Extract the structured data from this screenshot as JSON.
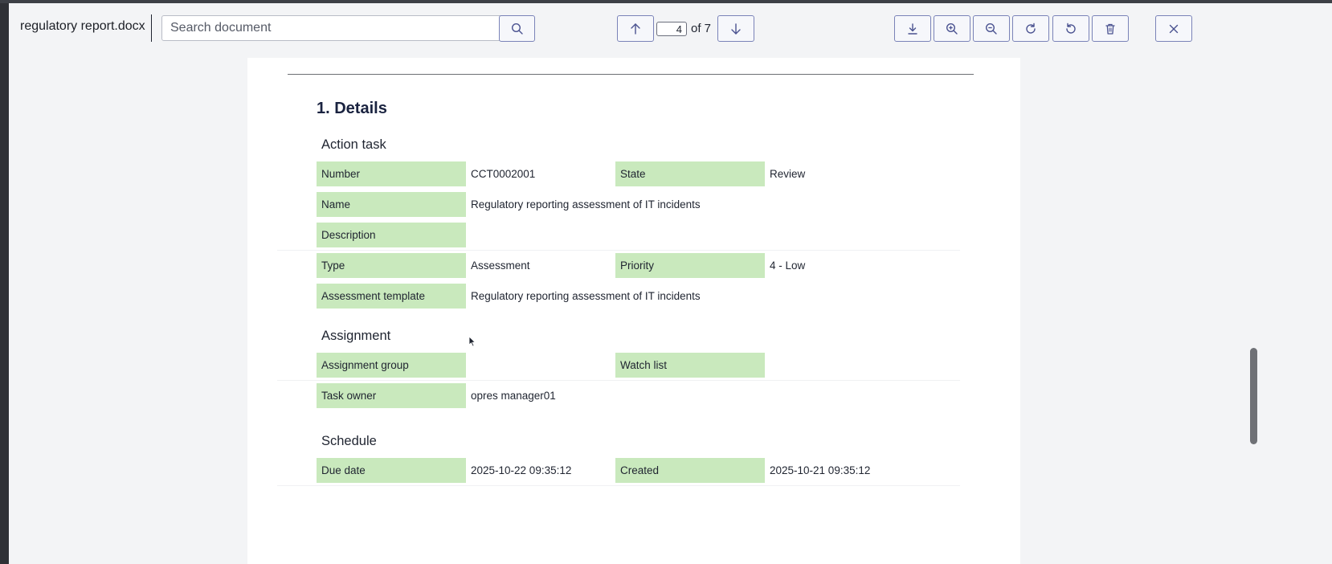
{
  "toolbar": {
    "document_name": "regulatory report.docx",
    "search_placeholder": "Search document",
    "search_icon": "search-icon",
    "page_current": "4",
    "page_of_label": "of 7",
    "buttons": [
      "previous-page",
      "next-page",
      "download",
      "zoom-in",
      "zoom-out",
      "rotate-clockwise",
      "rotate-counterclockwise",
      "delete",
      "close"
    ]
  },
  "document": {
    "section_title": "1. Details",
    "action_task": {
      "heading": "Action task",
      "number_label": "Number",
      "number_value": "CCT0002001",
      "state_label": "State",
      "state_value": "Review",
      "name_label": "Name",
      "name_value": "Regulatory reporting assessment of IT incidents",
      "description_label": "Description",
      "description_value": "",
      "type_label": "Type",
      "type_value": "Assessment",
      "priority_label": "Priority",
      "priority_value": "4 - Low",
      "template_label": "Assessment template",
      "template_value": "Regulatory reporting assessment of IT incidents"
    },
    "assignment": {
      "heading": "Assignment",
      "group_label": "Assignment group",
      "group_value": "",
      "watch_label": "Watch list",
      "watch_value": "",
      "owner_label": "Task owner",
      "owner_value": "opres manager01"
    },
    "schedule": {
      "heading": "Schedule",
      "due_label": "Due date",
      "due_value": "2025-10-22 09:35:12",
      "created_label": "Created",
      "created_value": "2025-10-21 09:35:12"
    }
  },
  "colors": {
    "label_fill": "#c9e9bd",
    "heading": "#1a2340",
    "button_border": "#7a83b8"
  }
}
